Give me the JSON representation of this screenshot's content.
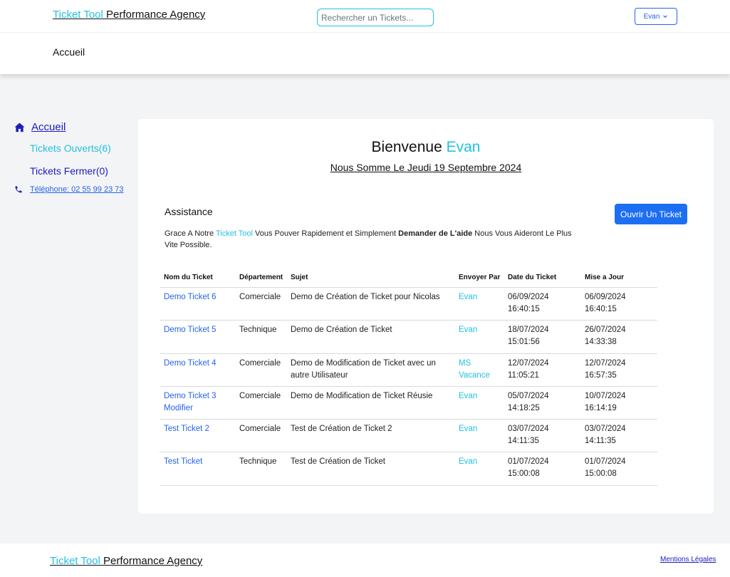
{
  "header": {
    "brand_accent": "Ticket Tool",
    "brand_rest": " Performance Agency",
    "search_placeholder": "Rechercher un Tickets...",
    "user_label": "Evan",
    "page_title": "Accueil"
  },
  "sidebar": {
    "home_label": "Accueil",
    "open_label": "Tickets Ouverts(6)",
    "closed_label": "Tickets Fermer(0)",
    "phone_label": "Téléphone: 02 55 99 23 73"
  },
  "main": {
    "welcome_prefix": "Bienvenue ",
    "welcome_name": "Evan",
    "date_line": "Nous Somme Le Jeudi 19 Septembre 2024",
    "assist_title": "Assistance",
    "assist_text_1": "Grace A Notre ",
    "assist_text_accent": "Ticket Tool",
    "assist_text_2": " Vous Pouver Rapidement et Simplement ",
    "assist_text_bold": "Demander de L'aide",
    "assist_text_3": " Nous Vous Aideront Le Plus Vite Possible.",
    "open_button": "Ouvrir Un Ticket"
  },
  "table": {
    "headers": [
      "Nom du Ticket",
      "Département",
      "Sujet",
      "Envoyer Par",
      "Date du Ticket",
      "Mise a Jour"
    ],
    "rows": [
      {
        "name": "Demo Ticket 6",
        "dept": "Comerciale",
        "subject": "Demo de Création de Ticket pour Nicolas",
        "sender": "Evan",
        "created": "06/09/2024 16:40:15",
        "updated": "06/09/2024 16:40:15"
      },
      {
        "name": "Demo Ticket 5",
        "dept": "Technique",
        "subject": "Demo de Création de Ticket",
        "sender": "Evan",
        "created": "18/07/2024 15:01:56",
        "updated": "26/07/2024 14:33:38"
      },
      {
        "name": "Demo Ticket 4",
        "dept": "Comerciale",
        "subject": "Demo de Modification de Ticket avec un autre Utilisateur",
        "sender": "MS Vacance",
        "created": "12/07/2024 11:05:21",
        "updated": "12/07/2024 16:57:35"
      },
      {
        "name": "Demo Ticket 3 Modifier",
        "dept": "Comerciale",
        "subject": "Demo de Modification de Ticket Réusie",
        "sender": "Evan",
        "created": "05/07/2024 14:18:25",
        "updated": "10/07/2024 16:14:19"
      },
      {
        "name": "Test Ticket 2",
        "dept": "Comerciale",
        "subject": "Test de Création de Ticket 2",
        "sender": "Evan",
        "created": "03/07/2024 14:11:35",
        "updated": "03/07/2024 14:11:35"
      },
      {
        "name": "Test Ticket",
        "dept": "Technique",
        "subject": "Test de Création de Ticket",
        "sender": "Evan",
        "created": "01/07/2024 15:00:08",
        "updated": "01/07/2024 15:00:08"
      }
    ]
  },
  "footer": {
    "brand_accent": "Ticket Tool",
    "brand_rest": " Performance Agency",
    "legal_label": "Mentions Légales"
  },
  "colors": {
    "accent_cyan": "#22c1e0",
    "link_blue": "#2563eb",
    "nav_indigo": "#1d1dbd",
    "button_blue": "#1d6ff2"
  },
  "icons": {
    "home": "home-icon",
    "phone": "phone-icon",
    "dropdown": "chevron-down-icon"
  }
}
